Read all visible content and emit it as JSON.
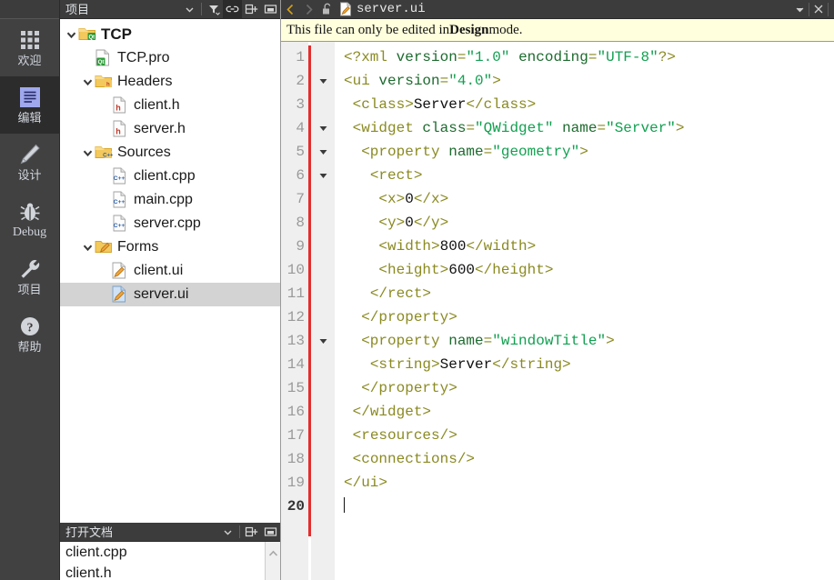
{
  "mode_bar": {
    "items": [
      {
        "label": "欢迎",
        "icon": "grid-icon",
        "selected": false,
        "latin": false
      },
      {
        "label": "编辑",
        "icon": "document-lines-icon",
        "selected": true,
        "latin": false
      },
      {
        "label": "设计",
        "icon": "pencil-icon",
        "selected": false,
        "latin": false
      },
      {
        "label": "Debug",
        "icon": "bug-icon",
        "selected": false,
        "latin": true
      },
      {
        "label": "项目",
        "icon": "wrench-icon",
        "selected": false,
        "latin": false
      },
      {
        "label": "帮助",
        "icon": "question-circle-icon",
        "selected": false,
        "latin": false
      }
    ]
  },
  "project_panel": {
    "header": {
      "title": "项目",
      "dropdown_icon": "chevron-down-icon",
      "filter_icon": "filter-icon",
      "link_icon": "link-icon",
      "link_active": true,
      "split_icon": "split-pane-add-icon",
      "collapse_icon": "collapse-panel-icon"
    },
    "tree": [
      {
        "label": "TCP",
        "icon": "qt-project-folder-icon",
        "indent": 0,
        "expanded": true,
        "arrow": true,
        "root": true,
        "selected": false
      },
      {
        "label": "TCP.pro",
        "icon": "qt-pro-file-icon",
        "indent": 1,
        "expanded": false,
        "arrow": false,
        "root": false,
        "selected": false
      },
      {
        "label": "Headers",
        "icon": "headers-folder-icon",
        "indent": 1,
        "expanded": true,
        "arrow": true,
        "root": false,
        "selected": false
      },
      {
        "label": "client.h",
        "icon": "header-file-icon",
        "indent": 2,
        "expanded": false,
        "arrow": false,
        "root": false,
        "selected": false
      },
      {
        "label": "server.h",
        "icon": "header-file-icon",
        "indent": 2,
        "expanded": false,
        "arrow": false,
        "root": false,
        "selected": false
      },
      {
        "label": "Sources",
        "icon": "sources-folder-icon",
        "indent": 1,
        "expanded": true,
        "arrow": true,
        "root": false,
        "selected": false
      },
      {
        "label": "client.cpp",
        "icon": "cpp-file-icon",
        "indent": 2,
        "expanded": false,
        "arrow": false,
        "root": false,
        "selected": false
      },
      {
        "label": "main.cpp",
        "icon": "cpp-file-icon",
        "indent": 2,
        "expanded": false,
        "arrow": false,
        "root": false,
        "selected": false
      },
      {
        "label": "server.cpp",
        "icon": "cpp-file-icon",
        "indent": 2,
        "expanded": false,
        "arrow": false,
        "root": false,
        "selected": false
      },
      {
        "label": "Forms",
        "icon": "forms-folder-icon",
        "indent": 1,
        "expanded": true,
        "arrow": true,
        "root": false,
        "selected": false
      },
      {
        "label": "client.ui",
        "icon": "ui-file-icon",
        "indent": 2,
        "expanded": false,
        "arrow": false,
        "root": false,
        "selected": false
      },
      {
        "label": "server.ui",
        "icon": "ui-file-selected-icon",
        "indent": 2,
        "expanded": false,
        "arrow": false,
        "root": false,
        "selected": true
      }
    ]
  },
  "open_documents": {
    "header": {
      "title": "打开文档",
      "dropdown_icon": "chevron-down-icon",
      "split_icon": "split-pane-add-icon",
      "collapse_icon": "collapse-panel-icon"
    },
    "items": [
      {
        "label": "client.cpp"
      },
      {
        "label": "client.h"
      }
    ],
    "scrollbar": {
      "up_arrow_icon": "scroll-up-arrow-icon"
    }
  },
  "editor": {
    "tab_bar": {
      "back_icon": "back-arrow-icon",
      "forward_icon": "forward-arrow-icon",
      "lock_icon": "unlocked-padlock-icon",
      "file_icon": "ui-file-icon",
      "file_name": "server.ui",
      "dropdown_icon": "chevron-down-icon",
      "close_icon": "close-x-icon"
    },
    "info_bar": {
      "text_before": "This file can only be edited in ",
      "text_bold": "Design",
      "text_after": " mode."
    },
    "gutter": {
      "first_line": 1,
      "last_line": 20,
      "current_line": 20,
      "change_bar_color": "#e42c2c"
    },
    "fold_markers": [
      2,
      4,
      5,
      6,
      13
    ],
    "lines": [
      {
        "n": 1,
        "html": "<span class=\"tg\">&lt;?xml </span><span class=\"at\">version</span><span class=\"tg\">=</span><span class=\"av\">\"1.0\"</span><span class=\"tg\"> </span><span class=\"at\">encoding</span><span class=\"tg\">=</span><span class=\"av\">\"UTF-8\"</span><span class=\"tg\">?&gt;</span>"
      },
      {
        "n": 2,
        "html": "<span class=\"tg\">&lt;ui </span><span class=\"at\">version</span><span class=\"tg\">=</span><span class=\"av\">\"4.0\"</span><span class=\"tg\">&gt;</span>"
      },
      {
        "n": 3,
        "html": " <span class=\"tg\">&lt;class&gt;</span><span class=\"tx\">Server</span><span class=\"tg\">&lt;/class&gt;</span>"
      },
      {
        "n": 4,
        "html": " <span class=\"tg\">&lt;widget </span><span class=\"at\">class</span><span class=\"tg\">=</span><span class=\"av\">\"QWidget\"</span><span class=\"tg\"> </span><span class=\"at\">name</span><span class=\"tg\">=</span><span class=\"av\">\"Server\"</span><span class=\"tg\">&gt;</span>"
      },
      {
        "n": 5,
        "html": "  <span class=\"tg\">&lt;property </span><span class=\"at\">name</span><span class=\"tg\">=</span><span class=\"av\">\"geometry\"</span><span class=\"tg\">&gt;</span>"
      },
      {
        "n": 6,
        "html": "   <span class=\"tg\">&lt;rect&gt;</span>"
      },
      {
        "n": 7,
        "html": "    <span class=\"tg\">&lt;x&gt;</span><span class=\"tx\">0</span><span class=\"tg\">&lt;/x&gt;</span>"
      },
      {
        "n": 8,
        "html": "    <span class=\"tg\">&lt;y&gt;</span><span class=\"tx\">0</span><span class=\"tg\">&lt;/y&gt;</span>"
      },
      {
        "n": 9,
        "html": "    <span class=\"tg\">&lt;width&gt;</span><span class=\"tx\">800</span><span class=\"tg\">&lt;/width&gt;</span>"
      },
      {
        "n": 10,
        "html": "    <span class=\"tg\">&lt;height&gt;</span><span class=\"tx\">600</span><span class=\"tg\">&lt;/height&gt;</span>"
      },
      {
        "n": 11,
        "html": "   <span class=\"tg\">&lt;/rect&gt;</span>"
      },
      {
        "n": 12,
        "html": "  <span class=\"tg\">&lt;/property&gt;</span>"
      },
      {
        "n": 13,
        "html": "  <span class=\"tg\">&lt;property </span><span class=\"at\">name</span><span class=\"tg\">=</span><span class=\"av\">\"windowTitle\"</span><span class=\"tg\">&gt;</span>"
      },
      {
        "n": 14,
        "html": "   <span class=\"tg\">&lt;string&gt;</span><span class=\"tx\">Server</span><span class=\"tg\">&lt;/string&gt;</span>"
      },
      {
        "n": 15,
        "html": "  <span class=\"tg\">&lt;/property&gt;</span>"
      },
      {
        "n": 16,
        "html": " <span class=\"tg\">&lt;/widget&gt;</span>"
      },
      {
        "n": 17,
        "html": " <span class=\"tg\">&lt;resources/&gt;</span>"
      },
      {
        "n": 18,
        "html": " <span class=\"tg\">&lt;connections/&gt;</span>"
      },
      {
        "n": 19,
        "html": "<span class=\"tg\">&lt;/ui&gt;</span>"
      },
      {
        "n": 20,
        "html": "<span class=\"cursor\"></span>"
      }
    ],
    "raw_text": "<?xml version=\"1.0\" encoding=\"UTF-8\"?>\n<ui version=\"4.0\">\n <class>Server</class>\n <widget class=\"QWidget\" name=\"Server\">\n  <property name=\"geometry\">\n   <rect>\n    <x>0</x>\n    <y>0</y>\n    <width>800</width>\n    <height>600</height>\n   </rect>\n  </property>\n  <property name=\"windowTitle\">\n   <string>Server</string>\n  </property>\n </widget>\n <resources/>\n <connections/>\n</ui>\n"
  },
  "colors": {
    "chrome_dark": "#3c3c3c",
    "mode_bar": "#414141",
    "mode_selected": "#2c2c2c",
    "info_bar": "#ffffdd",
    "gutter": "#efefef",
    "tree_selection": "#d3d3d3",
    "xml_tag": "#8a8a22",
    "xml_attr": "#1d6b2e",
    "xml_value": "#11a050"
  }
}
